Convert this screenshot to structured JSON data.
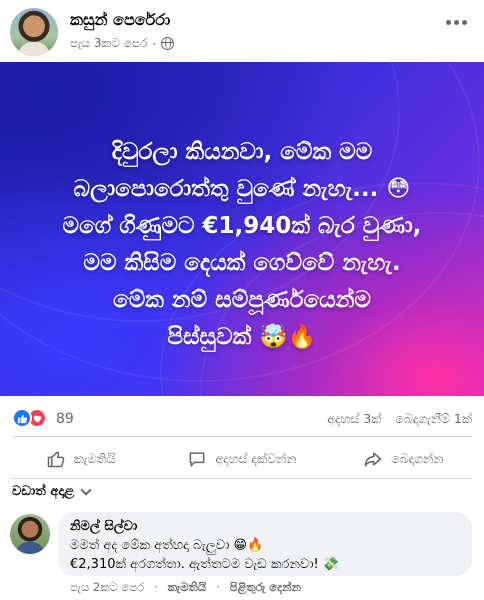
{
  "post": {
    "author": "කසුන් පෙරේරා",
    "time": "පැය 3කට පෙර",
    "separator": "·",
    "privacy_icon": "globe-icon",
    "more_icon": "more-horizontal-icon"
  },
  "image_text": {
    "line1": "දිවුරලා කියනවා, මේක මම",
    "line2": "බලාපොරොත්තු වුණේ නැහැ... 😳",
    "line3": "මගේ ගිණුමට €1,940ක් බැර වුණා,",
    "line4": "මම කිසිම දෙයක් ගෙව්වේ නැහැ.",
    "line5": "මේක නම් සම්පූර්ණයෙන්ම",
    "line6": "පිස්සුවක් 🤯🔥",
    "colors": {
      "background_start": "#2425b8",
      "background_end": "#b23adb",
      "text": "#ffffff"
    }
  },
  "reactions": {
    "count": "89",
    "comments": "අදහස් 3ක්",
    "shares": "බෙදාගැනීම් 1ක්",
    "icons": [
      "like-icon",
      "love-icon"
    ]
  },
  "actions": {
    "like": "කැමතියි",
    "comment": "අදහස් දක්වන්න",
    "share": "බෙදාගන්න"
  },
  "sort": {
    "label": "වඩාත් අදාළ"
  },
  "comment": {
    "author": "නිමල් සිල්වා",
    "line1": "මමත් අද මේක අත්හදා බැලුවා 😁🔥",
    "line2": "€2,310ක් අරගත්තා. ඇත්තටම වැඩ කරනවා! 💸",
    "time": "පැය 2කට පෙර",
    "like": "කැමතියි",
    "reply": "පිළිතුරු දෙන්න"
  }
}
